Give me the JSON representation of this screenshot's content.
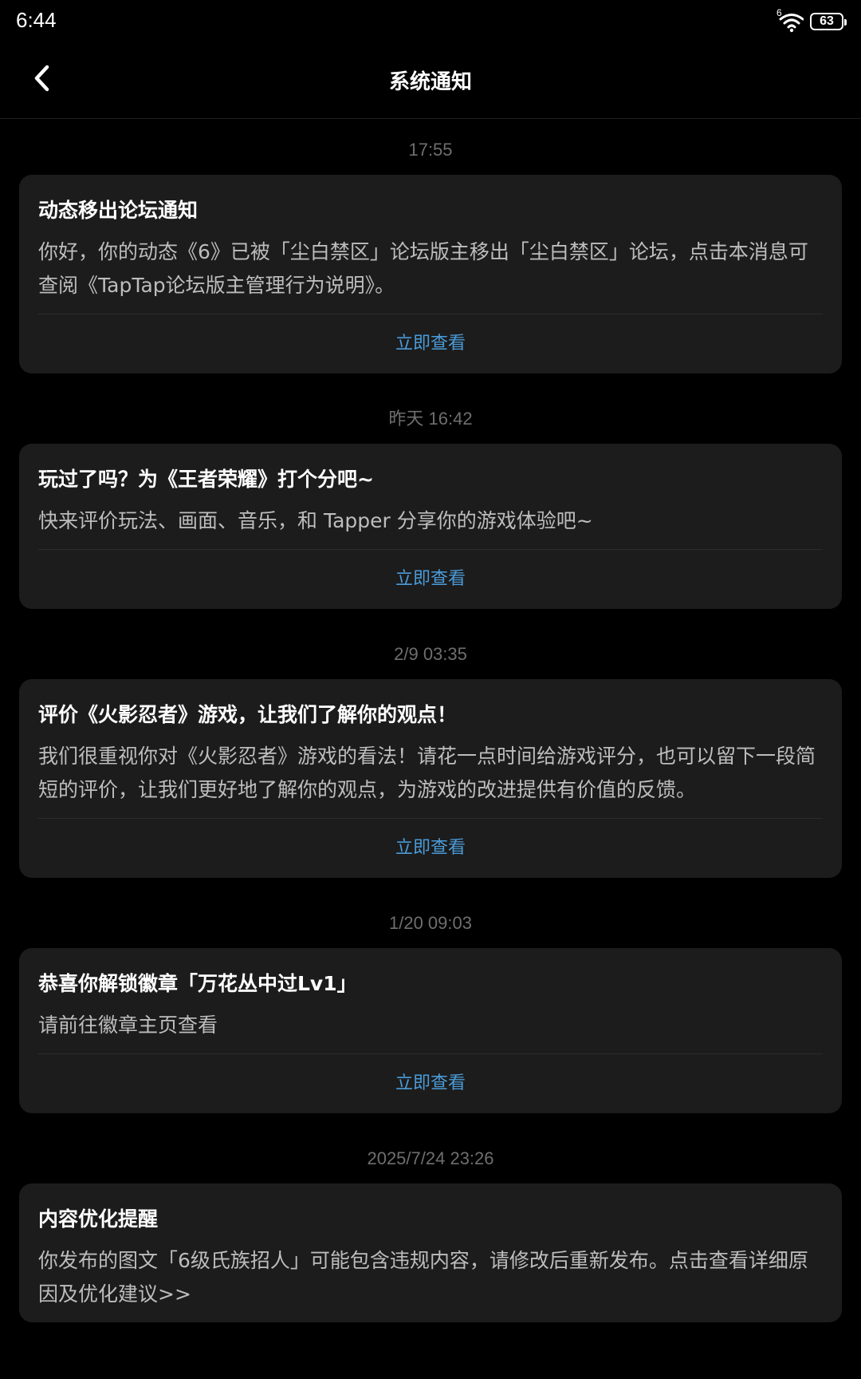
{
  "status_bar": {
    "time": "6:44",
    "wifi_label": "6",
    "battery": "63"
  },
  "header": {
    "title": "系统通知"
  },
  "notifications": [
    {
      "time": "17:55",
      "title": "动态移出论坛通知",
      "body": "你好，你的动态《6》已被「尘白禁区」论坛版主移出「尘白禁区」论坛，点击本消息可查阅《TapTap论坛版主管理行为说明》。",
      "action": "立即查看"
    },
    {
      "time": "昨天  16:42",
      "title": "玩过了吗？为《王者荣耀》打个分吧~",
      "body": "快来评价玩法、画面、音乐，和 Tapper 分享你的游戏体验吧~",
      "action": "立即查看"
    },
    {
      "time": "2/9  03:35",
      "title": "评价《火影忍者》游戏，让我们了解你的观点！",
      "body": "我们很重视你对《火影忍者》游戏的看法！请花一点时间给游戏评分，也可以留下一段简短的评价，让我们更好地了解你的观点，为游戏的改进提供有价值的反馈。",
      "action": "立即查看"
    },
    {
      "time": "1/20  09:03",
      "title": "恭喜你解锁徽章「万花丛中过Lv1」",
      "body": "请前往徽章主页查看",
      "action": "立即查看"
    },
    {
      "time": "2025/7/24  23:26",
      "title": "内容优化提醒",
      "body": "你发布的图文「6级氏族招人」可能包含违规内容，请修改后重新发布。点击查看详细原因及优化建议>>",
      "action": ""
    }
  ]
}
